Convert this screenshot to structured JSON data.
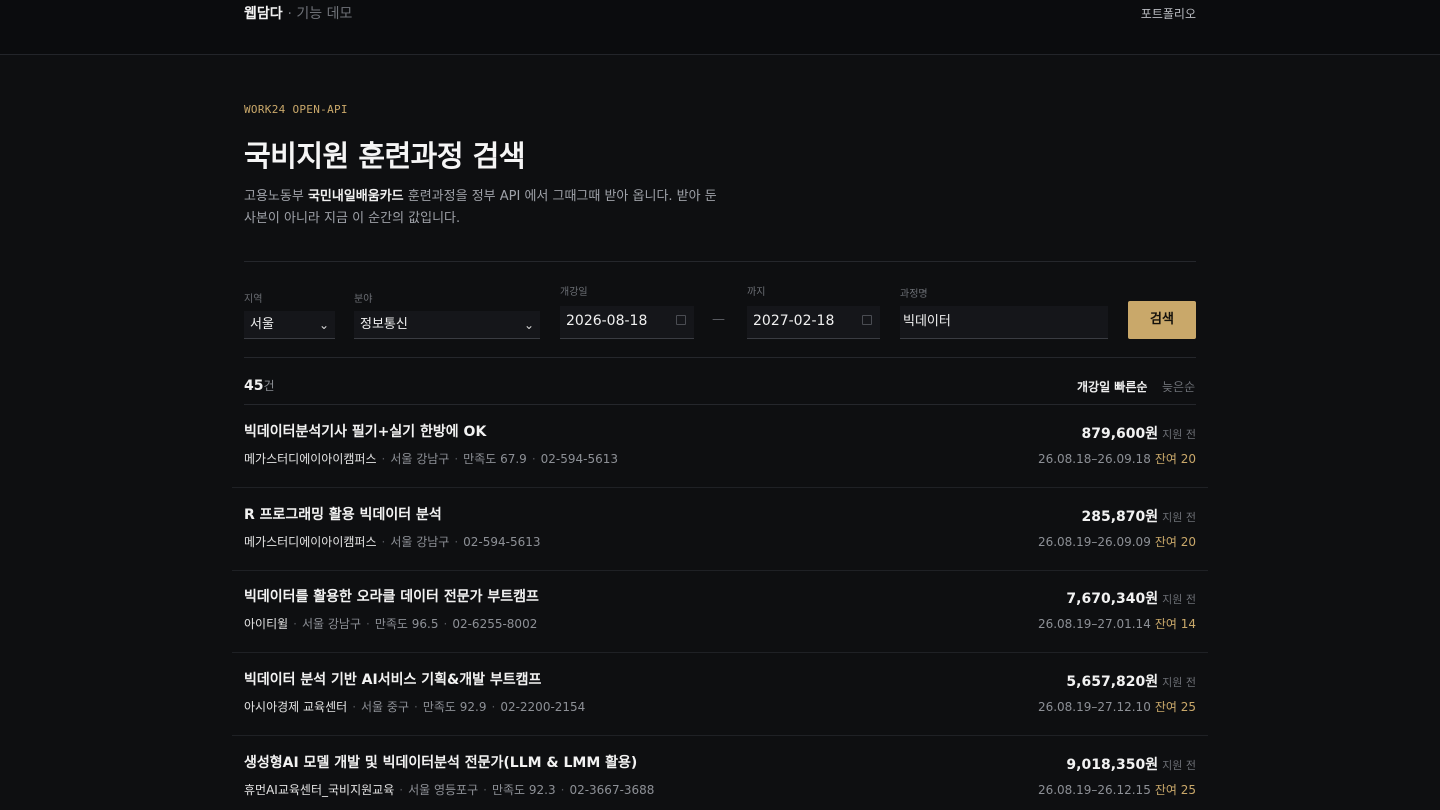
{
  "header": {
    "brand": "웹담다",
    "brand_sub": "· 기능 데모",
    "portfolio_link": "포트폴리오"
  },
  "hero": {
    "kicker": "WORK24 OPEN-API",
    "title": "국비지원 훈련과정 검색",
    "desc_pre": "고용노동부 ",
    "desc_bold": "국민내일배움카드",
    "desc_post": " 훈련과정을 정부 API 에서 그때그때 받아 옵니다. 받아 둔 사본이 아니라 지금 이 순간의 값입니다."
  },
  "filters": {
    "region_label": "지역",
    "region_value": "서울",
    "field_label": "분야",
    "field_value": "정보통신",
    "start_label": "개강일",
    "start_value": "2026-08-18",
    "end_label": "까지",
    "end_value": "2027-02-18",
    "dash": "—",
    "course_label": "과정명",
    "course_value": "빅데이터",
    "search_button": "검색"
  },
  "results": {
    "count": "45",
    "count_unit": "건",
    "sort_early": "개강일 빠른순",
    "sort_late": "늦은순",
    "support_label": "지원 전",
    "items": [
      {
        "title": "빅데이터분석기사 필기+실기 한방에 OK",
        "institution": "메가스터디에이아이캠퍼스",
        "location": "서울 강남구",
        "satisfaction": "만족도 67.9",
        "phone": "02-594-5613",
        "price": "879,600원",
        "dates": "26.08.18–26.09.18",
        "remaining": "잔여 20"
      },
      {
        "title": "R 프로그래밍 활용 빅데이터 분석",
        "institution": "메가스터디에이아이캠퍼스",
        "location": "서울 강남구",
        "satisfaction": "",
        "phone": "02-594-5613",
        "price": "285,870원",
        "dates": "26.08.19–26.09.09",
        "remaining": "잔여 20"
      },
      {
        "title": "빅데이터를 활용한 오라클 데이터 전문가 부트캠프",
        "institution": "아이티윌",
        "location": "서울 강남구",
        "satisfaction": "만족도 96.5",
        "phone": "02-6255-8002",
        "price": "7,670,340원",
        "dates": "26.08.19–27.01.14",
        "remaining": "잔여 14"
      },
      {
        "title": "빅데이터 분석 기반 AI서비스 기획&개발 부트캠프",
        "institution": "아시아경제 교육센터",
        "location": "서울 중구",
        "satisfaction": "만족도 92.9",
        "phone": "02-2200-2154",
        "price": "5,657,820원",
        "dates": "26.08.19–27.12.10",
        "remaining": "잔여 25"
      },
      {
        "title": "생성형AI 모델 개발 및 빅데이터분석 전문가(LLM & LMM 활용)",
        "institution": "휴먼AI교육센터_국비지원교육",
        "location": "서울 영등포구",
        "satisfaction": "만족도 92.3",
        "phone": "02-3667-3688",
        "price": "9,018,350원",
        "dates": "26.08.19–26.12.15",
        "remaining": "잔여 25"
      }
    ]
  }
}
